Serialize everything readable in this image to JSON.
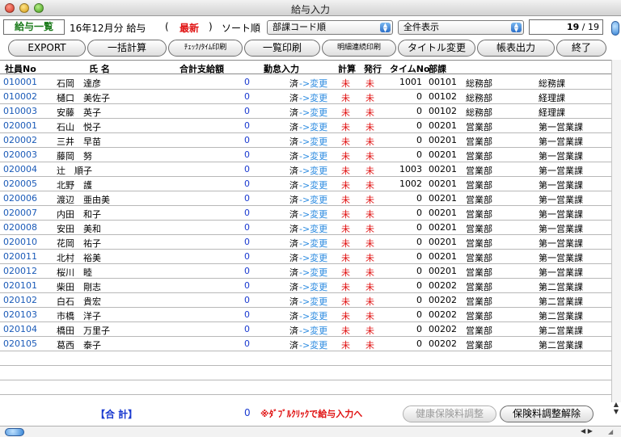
{
  "window": {
    "title": "給与入力"
  },
  "toolbar1": {
    "mode": "給与一覧",
    "period": "16年12月分 給与",
    "paren_open": "(",
    "status": "最新",
    "paren_close": ")",
    "sort_label": "ソート順",
    "sort_select": "部課コード順",
    "filter_select": "全件表示",
    "page_current": "19",
    "page_total": "/ 19"
  },
  "toolbar2": {
    "export": "EXPORT",
    "bulk_calc": "一括計算",
    "check_time_print": "ﾁｪｯｸ/ﾀｲﾑ印刷",
    "list_print": "一覧印刷",
    "detail_print": "明細連続印刷",
    "title_change": "タイトル変更",
    "report_output": "帳表出力",
    "exit": "終了"
  },
  "table": {
    "headers": {
      "no": "社員No",
      "name": "氏 名",
      "total": "合計支給額",
      "attendance": "勤怠入力",
      "calc": "計算",
      "issue": "発行",
      "time_no": "タイムNo",
      "dept": "部課"
    },
    "rows": [
      {
        "no": "010001",
        "name": "石岡　達彦",
        "amount": "0",
        "att": "済",
        "change": "->変更",
        "calc": "未",
        "issue": "未",
        "time": "1001",
        "dept": "00101",
        "dept_name": "総務部",
        "section": "総務課"
      },
      {
        "no": "010002",
        "name": "樋口　美佐子",
        "amount": "0",
        "att": "済",
        "change": "->変更",
        "calc": "未",
        "issue": "未",
        "time": "0",
        "dept": "00102",
        "dept_name": "総務部",
        "section": "経理課"
      },
      {
        "no": "010003",
        "name": "安藤　英子",
        "amount": "0",
        "att": "済",
        "change": "->変更",
        "calc": "未",
        "issue": "未",
        "time": "0",
        "dept": "00102",
        "dept_name": "総務部",
        "section": "経理課"
      },
      {
        "no": "020001",
        "name": "石山　悦子",
        "amount": "0",
        "att": "済",
        "change": "->変更",
        "calc": "未",
        "issue": "未",
        "time": "0",
        "dept": "00201",
        "dept_name": "営業部",
        "section": "第一営業課"
      },
      {
        "no": "020002",
        "name": "三井　早苗",
        "amount": "0",
        "att": "済",
        "change": "->変更",
        "calc": "未",
        "issue": "未",
        "time": "0",
        "dept": "00201",
        "dept_name": "営業部",
        "section": "第一営業課"
      },
      {
        "no": "020003",
        "name": "藤岡　努",
        "amount": "0",
        "att": "済",
        "change": "->変更",
        "calc": "未",
        "issue": "未",
        "time": "0",
        "dept": "00201",
        "dept_name": "営業部",
        "section": "第一営業課"
      },
      {
        "no": "020004",
        "name": "辻　順子",
        "amount": "0",
        "att": "済",
        "change": "->変更",
        "calc": "未",
        "issue": "未",
        "time": "1003",
        "dept": "00201",
        "dept_name": "営業部",
        "section": "第一営業課"
      },
      {
        "no": "020005",
        "name": "北野　護",
        "amount": "0",
        "att": "済",
        "change": "->変更",
        "calc": "未",
        "issue": "未",
        "time": "1002",
        "dept": "00201",
        "dept_name": "営業部",
        "section": "第一営業課"
      },
      {
        "no": "020006",
        "name": "渡辺　亜由美",
        "amount": "0",
        "att": "済",
        "change": "->変更",
        "calc": "未",
        "issue": "未",
        "time": "0",
        "dept": "00201",
        "dept_name": "営業部",
        "section": "第一営業課"
      },
      {
        "no": "020007",
        "name": "内田　和子",
        "amount": "0",
        "att": "済",
        "change": "->変更",
        "calc": "未",
        "issue": "未",
        "time": "0",
        "dept": "00201",
        "dept_name": "営業部",
        "section": "第一営業課"
      },
      {
        "no": "020008",
        "name": "安田　美和",
        "amount": "0",
        "att": "済",
        "change": "->変更",
        "calc": "未",
        "issue": "未",
        "time": "0",
        "dept": "00201",
        "dept_name": "営業部",
        "section": "第一営業課"
      },
      {
        "no": "020010",
        "name": "花岡　祐子",
        "amount": "0",
        "att": "済",
        "change": "->変更",
        "calc": "未",
        "issue": "未",
        "time": "0",
        "dept": "00201",
        "dept_name": "営業部",
        "section": "第一営業課"
      },
      {
        "no": "020011",
        "name": "北村　裕美",
        "amount": "0",
        "att": "済",
        "change": "->変更",
        "calc": "未",
        "issue": "未",
        "time": "0",
        "dept": "00201",
        "dept_name": "営業部",
        "section": "第一営業課"
      },
      {
        "no": "020012",
        "name": "桜川　睦",
        "amount": "0",
        "att": "済",
        "change": "->変更",
        "calc": "未",
        "issue": "未",
        "time": "0",
        "dept": "00201",
        "dept_name": "営業部",
        "section": "第一営業課"
      },
      {
        "no": "020101",
        "name": "柴田　剛志",
        "amount": "0",
        "att": "済",
        "change": "->変更",
        "calc": "未",
        "issue": "未",
        "time": "0",
        "dept": "00202",
        "dept_name": "営業部",
        "section": "第二営業課"
      },
      {
        "no": "020102",
        "name": "白石　貴宏",
        "amount": "0",
        "att": "済",
        "change": "->変更",
        "calc": "未",
        "issue": "未",
        "time": "0",
        "dept": "00202",
        "dept_name": "営業部",
        "section": "第二営業課"
      },
      {
        "no": "020103",
        "name": "市橋　洋子",
        "amount": "0",
        "att": "済",
        "change": "->変更",
        "calc": "未",
        "issue": "未",
        "time": "0",
        "dept": "00202",
        "dept_name": "営業部",
        "section": "第二営業課"
      },
      {
        "no": "020104",
        "name": "橋田　万里子",
        "amount": "0",
        "att": "済",
        "change": "->変更",
        "calc": "未",
        "issue": "未",
        "time": "0",
        "dept": "00202",
        "dept_name": "営業部",
        "section": "第二営業課"
      },
      {
        "no": "020105",
        "name": "葛西　泰子",
        "amount": "0",
        "att": "済",
        "change": "->変更",
        "calc": "未",
        "issue": "未",
        "time": "0",
        "dept": "00202",
        "dept_name": "営業部",
        "section": "第二営業課"
      }
    ]
  },
  "footer": {
    "total_label": "【合 計】",
    "total_value": "0",
    "hint": "※ﾀﾞﾌﾞﾙｸﾘｯｸで給与入力へ",
    "health_adjust": "健康保険料調整",
    "insurance_cancel": "保険料調整解除"
  },
  "icons": {
    "close": "close-icon",
    "minimize": "minimize-icon",
    "zoom": "zoom-icon",
    "toolbar_toggle": "toolbar-toggle-icon",
    "select_arrow": "updown-arrow-icon"
  },
  "colors": {
    "accent_blue": "#1a5ab8",
    "status_red": "#e01010",
    "mode_green": "#1a7a1a"
  }
}
